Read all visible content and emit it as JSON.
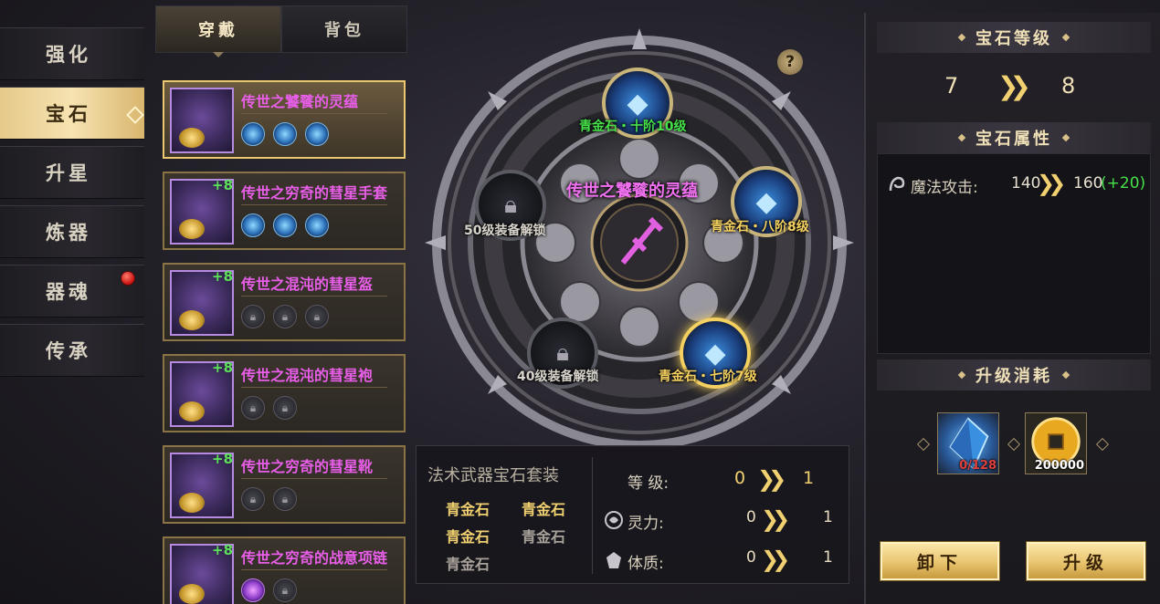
{
  "nav": {
    "items": [
      {
        "label": "强化"
      },
      {
        "label": "宝石"
      },
      {
        "label": "升星"
      },
      {
        "label": "炼器"
      },
      {
        "label": "器魂"
      },
      {
        "label": "传承"
      }
    ],
    "active_index": 1,
    "notify_index": 4
  },
  "tabs": {
    "worn": "穿戴",
    "bag": "背包"
  },
  "equipment": [
    {
      "name": "传世之饕餮的灵蕴",
      "plus": "",
      "slots": [
        "gem",
        "gem",
        "gem"
      ]
    },
    {
      "name": "传世之穷奇的彗星手套",
      "plus": "+8",
      "slots": [
        "gem",
        "gem",
        "gem"
      ]
    },
    {
      "name": "传世之混沌的彗星盔",
      "plus": "+8",
      "slots": [
        "lock",
        "lock",
        "lock"
      ]
    },
    {
      "name": "传世之混沌的彗星袍",
      "plus": "+8",
      "slots": [
        "lock",
        "lock"
      ]
    },
    {
      "name": "传世之穷奇的彗星靴",
      "plus": "+8",
      "slots": [
        "lock",
        "lock"
      ]
    },
    {
      "name": "传世之穷奇的战意项链",
      "plus": "+8",
      "slots": [
        "purple",
        "lock"
      ]
    }
  ],
  "wheel": {
    "center_title": "传世之饕餮的灵蕴",
    "help": "?",
    "nodes": {
      "top": "青金石・十阶10级",
      "right": "青金石・八阶8级",
      "bottom_right": "青金石・七阶7级",
      "left": "50级装备解锁",
      "bottom_left": "40级装备解锁"
    },
    "colors": {
      "green": "#46e04a",
      "yellow": "#f4d060",
      "grey": "#d8d4cc"
    }
  },
  "set": {
    "title": "法术武器宝石套装",
    "gems": [
      {
        "label": "青金石",
        "active": true
      },
      {
        "label": "青金石",
        "active": true
      },
      {
        "label": "青金石",
        "active": true
      },
      {
        "label": "青金石",
        "active": false
      },
      {
        "label": "青金石",
        "active": false
      }
    ],
    "level": {
      "label": "等 级:",
      "from": "0",
      "to": "1"
    },
    "stats": [
      {
        "icon": "spirit-icon",
        "label": "灵力:",
        "from": "0",
        "to": "1"
      },
      {
        "icon": "constitution-icon",
        "label": "体质:",
        "from": "0",
        "to": "1"
      }
    ]
  },
  "right": {
    "level_head": "宝石等级",
    "level_from": "7",
    "level_to": "8",
    "attr_head": "宝石属性",
    "attr": {
      "icon": "magic-attack-icon",
      "label": "魔法攻击:",
      "from": "140",
      "to": "160",
      "bonus": "(+20)"
    },
    "cost_head": "升级消耗",
    "costs": [
      {
        "icon": "blue-crystal-icon",
        "count": "0/128",
        "count_color": "#e0403a"
      },
      {
        "icon": "gold-coin-icon",
        "count": "200000",
        "count_color": "#ffffff"
      }
    ],
    "unequip": "卸下",
    "upgrade": "升级"
  }
}
